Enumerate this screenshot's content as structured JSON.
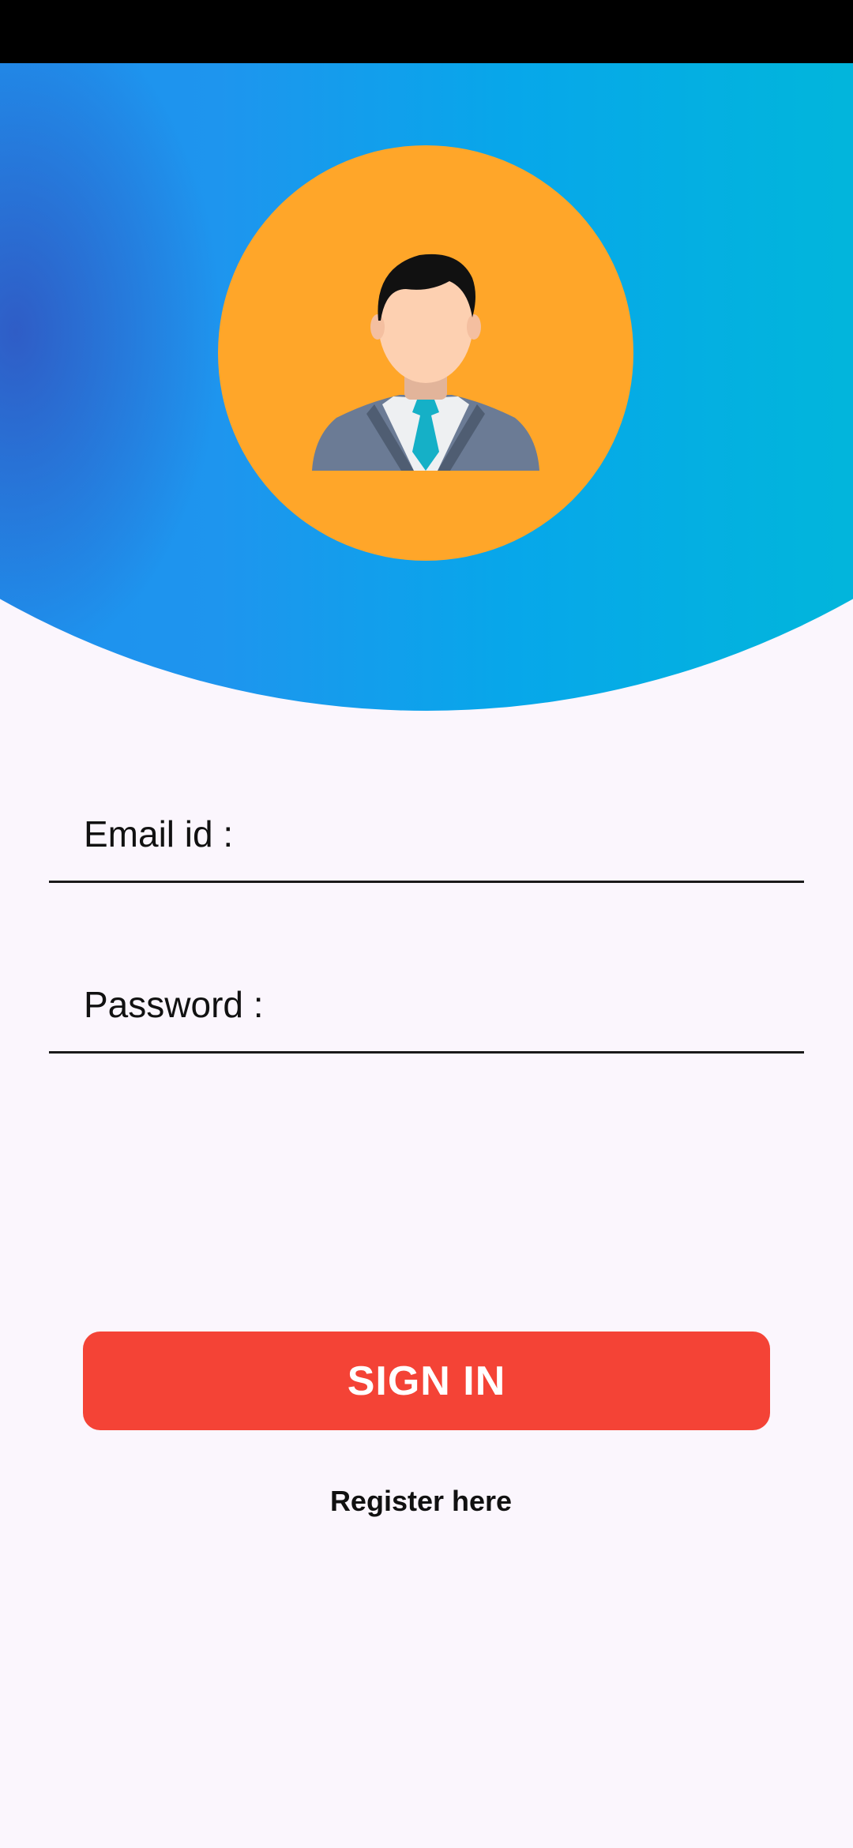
{
  "status_bar": {},
  "header": {
    "avatar_icon": "businessman-avatar-icon",
    "colors": {
      "gradient_start": "#1e88ec",
      "gradient_end": "#00c2d3",
      "avatar_bg": "#ffa629"
    }
  },
  "form": {
    "email_label": "Email id :",
    "email_value": "",
    "password_label": "Password :",
    "password_value": ""
  },
  "actions": {
    "signin_label": "SIGN IN",
    "signin_color": "#f44336",
    "register_label": "Register here"
  }
}
